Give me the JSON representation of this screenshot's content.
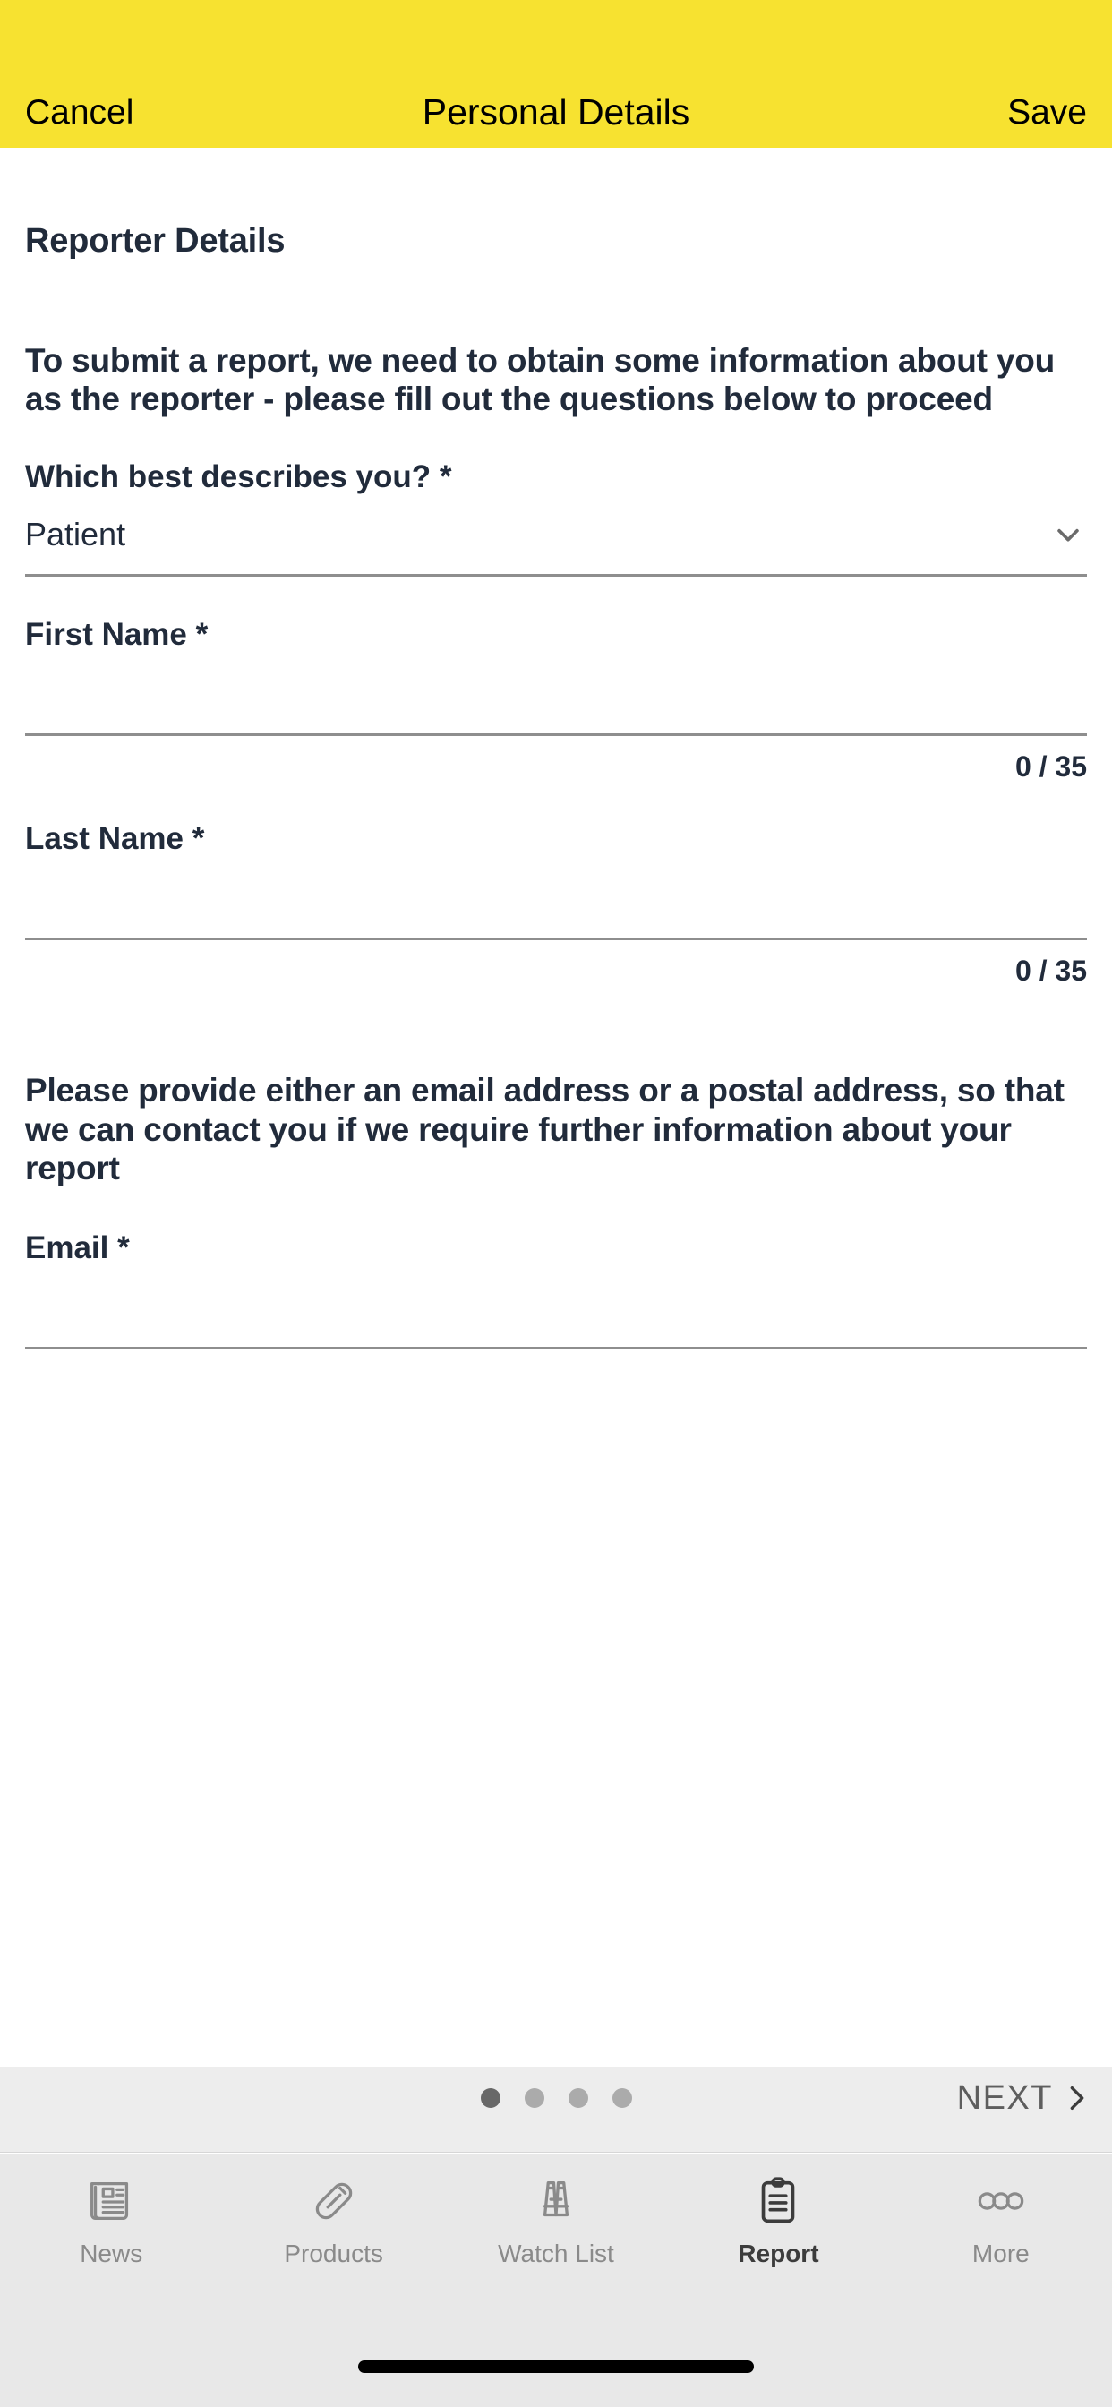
{
  "navbar": {
    "cancel_label": "Cancel",
    "title": "Personal Details",
    "save_label": "Save",
    "background_color": "#F7E230"
  },
  "form": {
    "section_title": "Reporter Details",
    "lead_paragraph": "To submit a report, we need to obtain some information about you as the reporter - please fill out the questions below to proceed",
    "describes_you": {
      "label": "Which best describes you? *",
      "selected_value": "Patient",
      "icon": "chevron-down-icon"
    },
    "first_name": {
      "label": "First Name *",
      "value": "",
      "placeholder": "",
      "counter": "0 / 35"
    },
    "last_name": {
      "label": "Last Name *",
      "value": "",
      "placeholder": "",
      "counter": "0 / 35"
    },
    "contact_paragraph": "Please provide either an email address or a postal address, so that we can contact you if we require further information about your report",
    "email": {
      "label": "Email *",
      "value": "",
      "placeholder": ""
    }
  },
  "pagination": {
    "total_dots": 4,
    "active_index": 0,
    "next_label": "NEXT",
    "next_icon": "chevron-right-icon"
  },
  "tabbar": {
    "active_index": 3,
    "items": [
      {
        "label": "News",
        "icon": "newspaper-icon"
      },
      {
        "label": "Products",
        "icon": "pill-capsule-icon"
      },
      {
        "label": "Watch List",
        "icon": "binoculars-icon"
      },
      {
        "label": "Report",
        "icon": "clipboard-icon"
      },
      {
        "label": "More",
        "icon": "three-circles-icon"
      }
    ]
  },
  "colors": {
    "accent_yellow": "#F7E230",
    "text_dark": "#212B3B",
    "muted_gray": "#8A8A8A",
    "underline_gray": "#8E8E8E",
    "tabbar_bg": "#E8E8E8",
    "pagebar_bg": "#EDEDED"
  }
}
